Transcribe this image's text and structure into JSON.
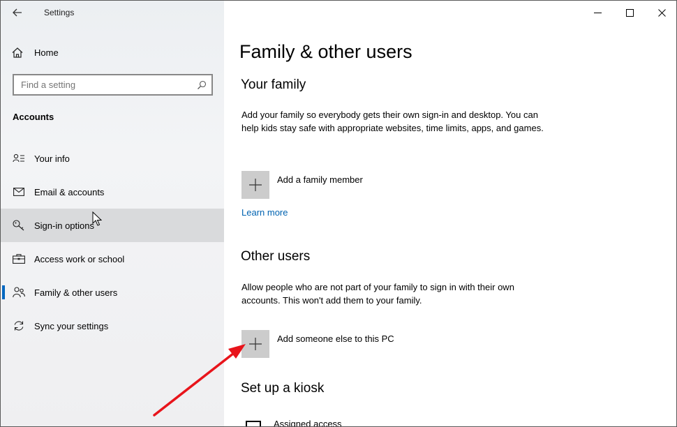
{
  "window": {
    "app_title": "Settings",
    "controls": [
      "minimize",
      "maximize",
      "close"
    ]
  },
  "sidebar": {
    "home_label": "Home",
    "search_placeholder": "Find a setting",
    "section_heading": "Accounts",
    "items": [
      {
        "label": "Your info",
        "icon": "person-card-icon"
      },
      {
        "label": "Email & accounts",
        "icon": "mail-icon"
      },
      {
        "label": "Sign-in options",
        "icon": "key-icon",
        "state": "hover"
      },
      {
        "label": "Access work or school",
        "icon": "briefcase-icon"
      },
      {
        "label": "Family & other users",
        "icon": "people-icon",
        "state": "active"
      },
      {
        "label": "Sync your settings",
        "icon": "sync-icon"
      }
    ]
  },
  "main": {
    "page_title": "Family & other users",
    "family": {
      "heading": "Your family",
      "description": "Add your family so everybody gets their own sign-in and desktop. You can help kids stay safe with appropriate websites, time limits, apps, and games.",
      "add_label": "Add a family member",
      "learn_more": "Learn more"
    },
    "other_users": {
      "heading": "Other users",
      "description": "Allow people who are not part of your family to sign in with their own accounts. This won't add them to your family.",
      "add_label": "Add someone else to this PC"
    },
    "kiosk": {
      "heading": "Set up a kiosk",
      "item_label": "Assigned access"
    }
  },
  "colors": {
    "accent": "#0067c0",
    "link": "#0063b1",
    "annotation_arrow": "#e8141b",
    "plus_tile": "#cccccc"
  }
}
